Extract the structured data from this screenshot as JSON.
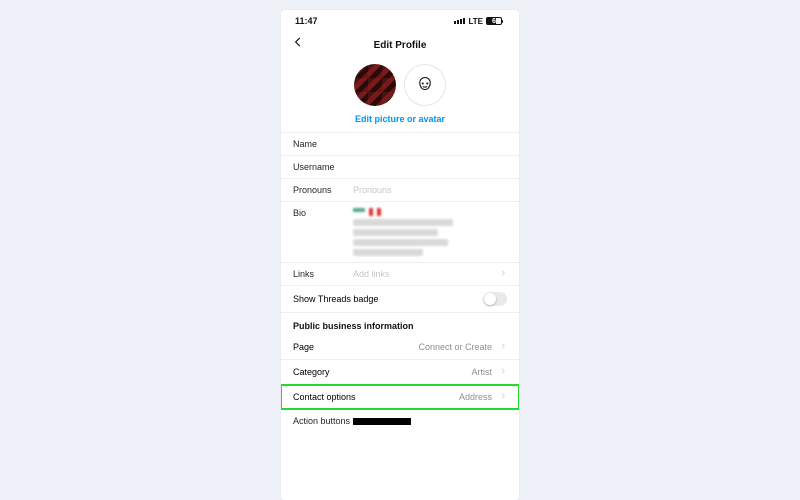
{
  "statusbar": {
    "time": "11:47",
    "network": "LTE",
    "battery": "62"
  },
  "nav": {
    "title": "Edit Profile"
  },
  "editPictureLink": "Edit picture or avatar",
  "fields": {
    "name": {
      "label": "Name",
      "value": ""
    },
    "username": {
      "label": "Username",
      "value": ""
    },
    "pronouns": {
      "label": "Pronouns",
      "placeholder": "Pronouns"
    },
    "bio": {
      "label": "Bio"
    },
    "links": {
      "label": "Links",
      "placeholder": "Add links"
    }
  },
  "threads": {
    "label": "Show Threads badge",
    "on": false
  },
  "business": {
    "sectionTitle": "Public business information",
    "page": {
      "label": "Page",
      "value": "Connect or Create"
    },
    "category": {
      "label": "Category",
      "value": "Artist"
    },
    "contact": {
      "label": "Contact options",
      "value": "Address"
    },
    "actionButtons": {
      "label": "Action buttons"
    }
  }
}
